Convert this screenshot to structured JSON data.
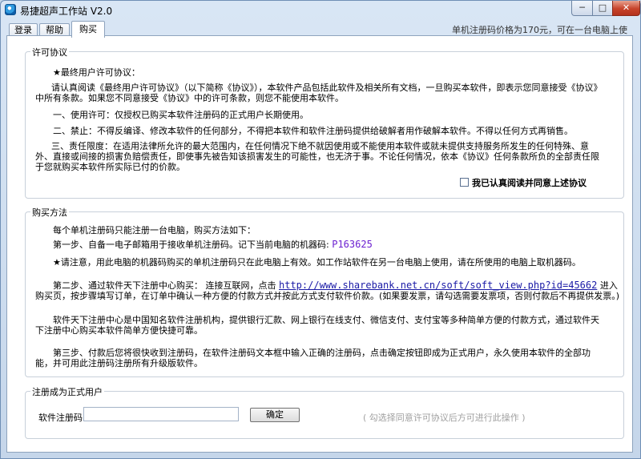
{
  "window": {
    "title": "易捷超声工作站 V2.0",
    "minimize_label": "─",
    "maximize_label": "□",
    "close_label": "✕"
  },
  "tabs": [
    {
      "label": "登录"
    },
    {
      "label": "帮助"
    },
    {
      "label": "购买",
      "active": true
    }
  ],
  "price_note": "单机注册码价格为170元，可在一台电脑上使用。",
  "license": {
    "legend": "许可协议",
    "heading": "★最终用户许可协议：",
    "intro": "请认真阅读《最终用户许可协议》（以下简称《协议》），本软件产品包括此软件及相关所有文档，一旦购买本软件，即表示您同意接受《协议》中所有条款。如果您不同意接受《协议》中的许可条款，则您不能使用本软件。",
    "item1": "一、使用许可：仅授权已购买本软件注册码的正式用户长期使用。",
    "item2": "二、禁止：不得反编译、修改本软件的任何部分，不得把本软件和软件注册码提供给破解者用作破解本软件。不得以任何方式再销售。",
    "item3": "三、责任限度：在适用法律所允许的最大范围内，在任何情况下绝不就因使用或不能使用本软件或就未提供支持服务所发生的任何特殊、意外、直接或间接的损害负赔偿责任，即使事先被告知该损害发生的可能性，也无济于事。不论任何情况，依本《协议》任何条款所负的全部责任限于您就购买本软件所实际已付的价款。",
    "agree_label": "我已认真阅读并同意上述协议",
    "agree_checked": false
  },
  "purchase": {
    "legend": "购买方法",
    "line1": "每个单机注册码只能注册一台电脑，购买方法如下：",
    "step1_text": "第一步、自备一电子邮箱用于接收单机注册码。记下当前电脑的机器码:",
    "machine_code": "P163625",
    "notice": "★请注意，用此电脑的机器码购买的单机注册码只在此电脑上有效。如工作站软件在另一台电脑上使用，请在所使用的电脑上取机器码。",
    "step2_prefix": "第二步、通过软件天下注册中心购买：  连接互联网，点击",
    "step2_link": "http://www.sharebank.net.cn/soft/soft_view.php?id=45662",
    "step2_suffix": "进入",
    "step2_line2": "购买页，按步骤填写订单，在订单中确认一种方便的付款方式并按此方式支付软件价款。(如果要发票，请勾选需要发票项，否则付款后不再提供发票。)",
    "center_info": "软件天下注册中心是中国知名软件注册机构，提供银行汇款、网上银行在线支付、微信支付、支付宝等多种简单方便的付款方式，通过软件天下注册中心购买本软件简单方便快捷可靠。",
    "step3": "第三步、付款后您将很快收到注册码，在软件注册码文本框中输入正确的注册码，点击确定按钮即成为正式用户，永久使用本软件的全部功能，并可用此注册码注册所有升级版软件。"
  },
  "register": {
    "legend": "注册成为正式用户",
    "code_label": "软件注册码",
    "code_value": "",
    "confirm_label": "确定",
    "hint": "( 勾选择同意许可协议后方可进行此操作 )"
  }
}
